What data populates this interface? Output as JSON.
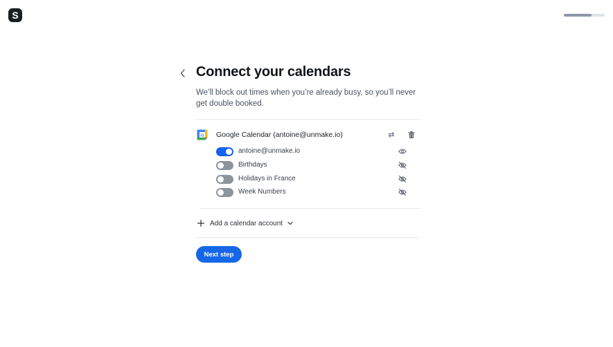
{
  "brand": {
    "logo_letter": "S"
  },
  "progress": {
    "fraction": 0.67
  },
  "page": {
    "title": "Connect your calendars",
    "subtitle": "We’ll block out times when you’re already busy, so you’ll never get double booked."
  },
  "account": {
    "title": "Google Calendar (antoine@unmake.io)",
    "icon": "google-calendar-icon",
    "icon_day": "31",
    "actions": [
      "sync-icon",
      "trash-icon"
    ],
    "calendars": [
      {
        "label": "antoine@unmake.io",
        "enabled": true,
        "visibility_icon": "eye-icon"
      },
      {
        "label": "Birthdays",
        "enabled": false,
        "visibility_icon": "eye-off-icon"
      },
      {
        "label": "Holidays in France",
        "enabled": false,
        "visibility_icon": "eye-off-icon"
      },
      {
        "label": "Week Numbers",
        "enabled": false,
        "visibility_icon": "eye-off-icon"
      }
    ]
  },
  "add_account": {
    "label": "Add a calendar account"
  },
  "next_button": {
    "label": "Next step"
  },
  "colors": {
    "accent": "#1667e8",
    "toggle_off": "#8e949c",
    "text": "#111418",
    "muted": "#4a5160"
  }
}
